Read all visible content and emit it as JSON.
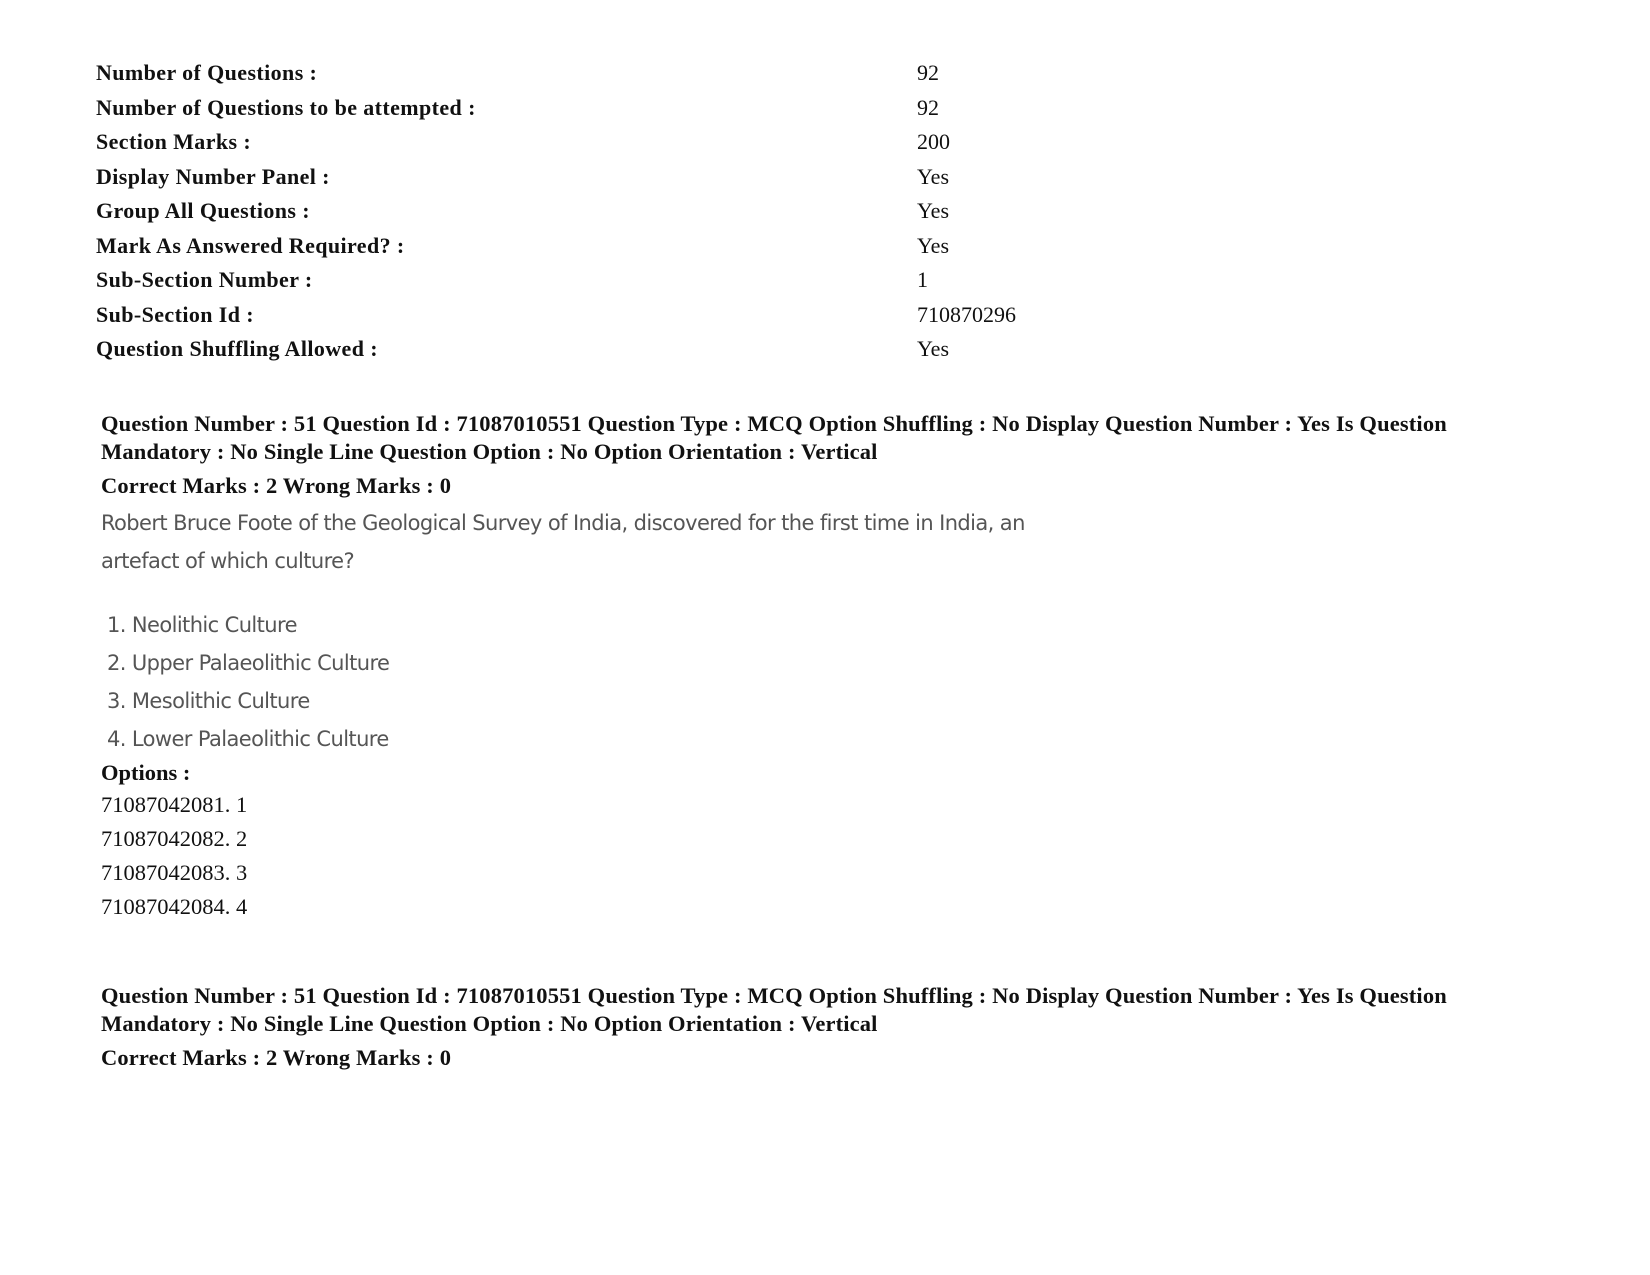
{
  "section_info": [
    {
      "label": "Number of Questions :",
      "value": "92"
    },
    {
      "label": "Number of Questions to be attempted :",
      "value": "92"
    },
    {
      "label": "Section Marks :",
      "value": "200"
    },
    {
      "label": "Display Number Panel :",
      "value": "Yes"
    },
    {
      "label": "Group All Questions :",
      "value": "Yes"
    },
    {
      "label": "Mark As Answered Required? :",
      "value": "Yes"
    },
    {
      "label": "Sub-Section Number :",
      "value": "1"
    },
    {
      "label": "Sub-Section Id :",
      "value": "710870296"
    },
    {
      "label": "Question Shuffling Allowed :",
      "value": "Yes"
    }
  ],
  "questions": [
    {
      "header": "Question Number : 51 Question Id : 71087010551 Question Type : MCQ Option Shuffling : No Display Question Number : Yes Is Question Mandatory : No Single Line Question Option : No Option Orientation : Vertical",
      "marks": "Correct Marks : 2 Wrong Marks : 0",
      "text": "Robert Bruce Foote of the Geological Survey of India, discovered for the first time in India, an artefact of which culture?",
      "answers": [
        "1. Neolithic Culture",
        "2. Upper Palaeolithic Culture",
        "3. Mesolithic Culture",
        "4. Lower Palaeolithic Culture"
      ],
      "options_label": "Options :",
      "option_ids": [
        "71087042081. 1",
        "71087042082. 2",
        "71087042083. 3",
        "71087042084. 4"
      ]
    },
    {
      "header": "Question Number : 51 Question Id : 71087010551 Question Type : MCQ Option Shuffling : No Display Question Number : Yes Is Question Mandatory : No Single Line Question Option : No Option Orientation : Vertical",
      "marks": "Correct Marks : 2 Wrong Marks : 0"
    }
  ]
}
